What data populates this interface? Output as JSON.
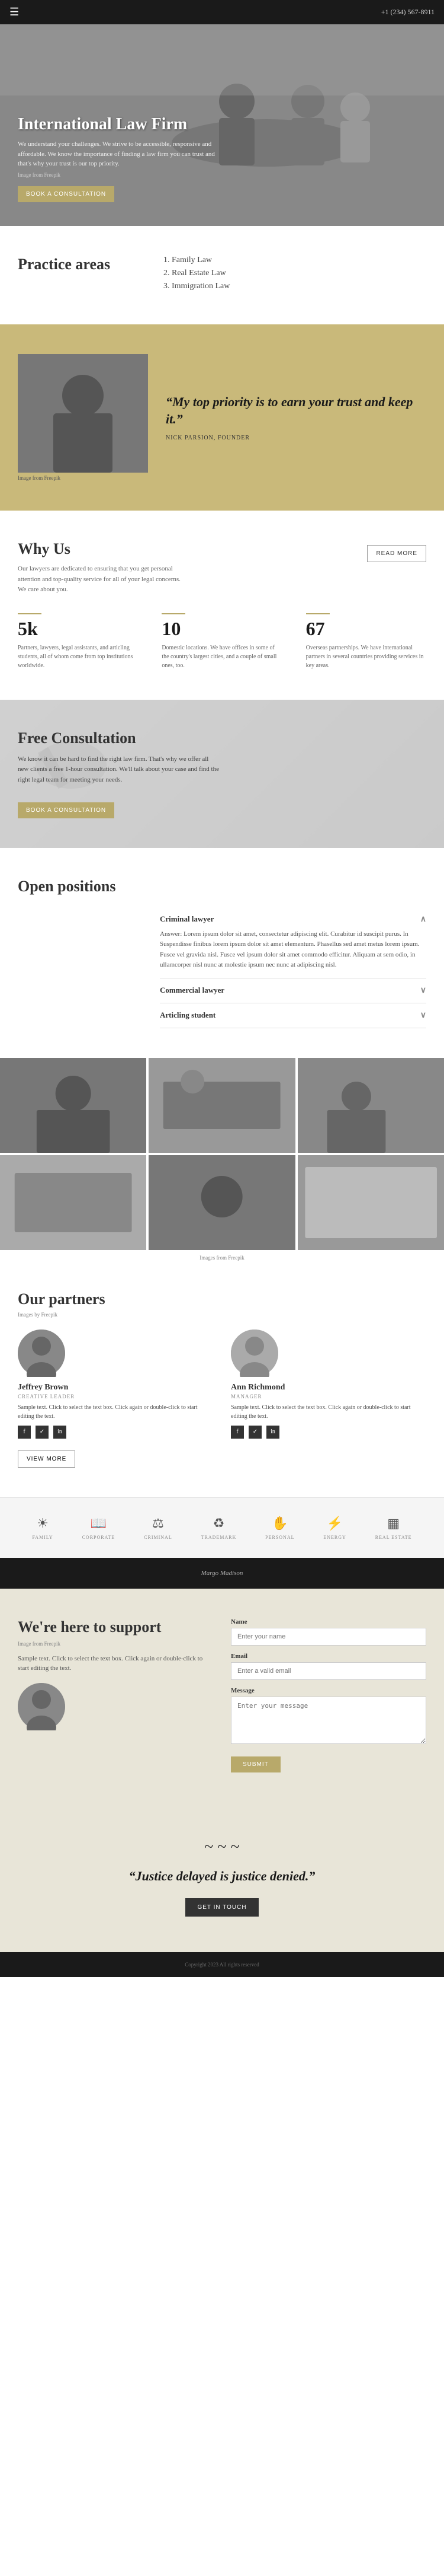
{
  "nav": {
    "phone": "+1 (234) 567-8911",
    "menu_icon": "☰"
  },
  "hero": {
    "title": "International Law Firm",
    "description": "We understand your challenges. We strive to be accessible, responsive and affordable. We know the importance of finding a law firm you can trust and that's why your trust is our top priority.",
    "img_from": "Image from Freepik",
    "cta_label": "BOOK A CONSULTATION"
  },
  "practice_areas": {
    "heading": "Practice areas",
    "items": [
      {
        "label": "Family Law"
      },
      {
        "label": "Real Estate Law"
      },
      {
        "label": "Immigration Law"
      }
    ]
  },
  "quote_section": {
    "quote": "“My top priority is to earn your trust and keep it.”",
    "attribution": "NICK PARSION, FOUNDER",
    "img_from": "Image from Freepik"
  },
  "why_us": {
    "heading": "Why Us",
    "description": "Our lawyers are dedicated to ensuring that you get personal attention and top-quality service for all of your legal concerns. We care about you.",
    "read_more_label": "READ MORE",
    "stats": [
      {
        "number": "5k",
        "description": "Partners, lawyers, legal assistants, and articling students, all of whom come from top institutions worldwide."
      },
      {
        "number": "10",
        "description": "Domestic locations. We have offices in some of the country's largest cities, and a couple of small ones, too."
      },
      {
        "number": "67",
        "description": "Overseas partnerships. We have international partners in several countries providing services in key areas."
      }
    ]
  },
  "free_consult": {
    "heading": "Free Consultation",
    "description": "We know it can be hard to find the right law firm. That's why we offer all new clients a free 1-hour consultation. We'll talk about your case and find the right legal team for meeting your needs.",
    "cta_label": "BOOK A CONSULTATION"
  },
  "open_positions": {
    "heading": "Open positions",
    "positions": [
      {
        "title": "Criminal lawyer",
        "is_open": true,
        "content": "Answer: Lorem ipsum dolor sit amet, consectetur adipiscing elit. Curabitur id suscipit purus. In Suspendisse finibus lorem ipsum dolor sit amet elementum. Phasellus sed amet metus lorem ipsum. Fusce vel gravida nisl. Fusce vel ipsum dolor sit amet commodo efficitur. Aliquam at sem odio, in ullamcorper nisl nunc at molestie ipsum nec nunc at adipiscing nisl."
      },
      {
        "title": "Commercial lawyer",
        "is_open": false,
        "content": ""
      },
      {
        "title": "Articling student",
        "is_open": false,
        "content": ""
      }
    ]
  },
  "photo_grid": {
    "caption": "Images from Freepik",
    "cells": [
      1,
      2,
      3,
      4,
      5,
      6
    ]
  },
  "partners": {
    "heading": "Our partners",
    "img_from": "Images by Freepik",
    "view_more_label": "VIEW MORE",
    "people": [
      {
        "name": "Jeffrey Brown",
        "role": "CREATIVE LEADER",
        "description": "Sample text. Click to select the text box. Click again or double-click to start editing the text.",
        "socials": [
          "f",
          "✓",
          "in"
        ]
      },
      {
        "name": "Ann Richmond",
        "role": "MANAGER",
        "description": "Sample text. Click to select the text box. Click again or double-click to start editing the text.",
        "socials": [
          "f",
          "✓",
          "in"
        ]
      }
    ]
  },
  "icon_row": {
    "items": [
      {
        "symbol": "☀",
        "label": "FAMILY"
      },
      {
        "symbol": "📖",
        "label": "CORPORATE"
      },
      {
        "symbol": "⚖",
        "label": "CRIMINAL"
      },
      {
        "symbol": "♻",
        "label": "TRADEMARK"
      },
      {
        "symbol": "✋",
        "label": "PERSONAL"
      },
      {
        "symbol": "⚡",
        "label": "ENERGY"
      },
      {
        "symbol": "▦",
        "label": "REAL ESTATE"
      }
    ]
  },
  "dark_strip": {
    "text": "Margo Madison"
  },
  "support": {
    "heading": "We're here to support",
    "img_from": "Image from Freepik",
    "description": "Sample text. Click to select the text box. Click again or double-click to start editing the text.",
    "form": {
      "name_label": "Name",
      "name_placeholder": "Enter your name",
      "email_label": "Email",
      "email_placeholder": "Enter a valid email",
      "message_label": "Message",
      "message_placeholder": "Enter your message",
      "submit_label": "SUBMIT"
    }
  },
  "quote_banner": {
    "quote": "“Justice delayed is justice denied.”",
    "cta_label": "GET IN TOUCH"
  },
  "footer": {
    "text": "Copyright 2023 All rights reserved"
  }
}
